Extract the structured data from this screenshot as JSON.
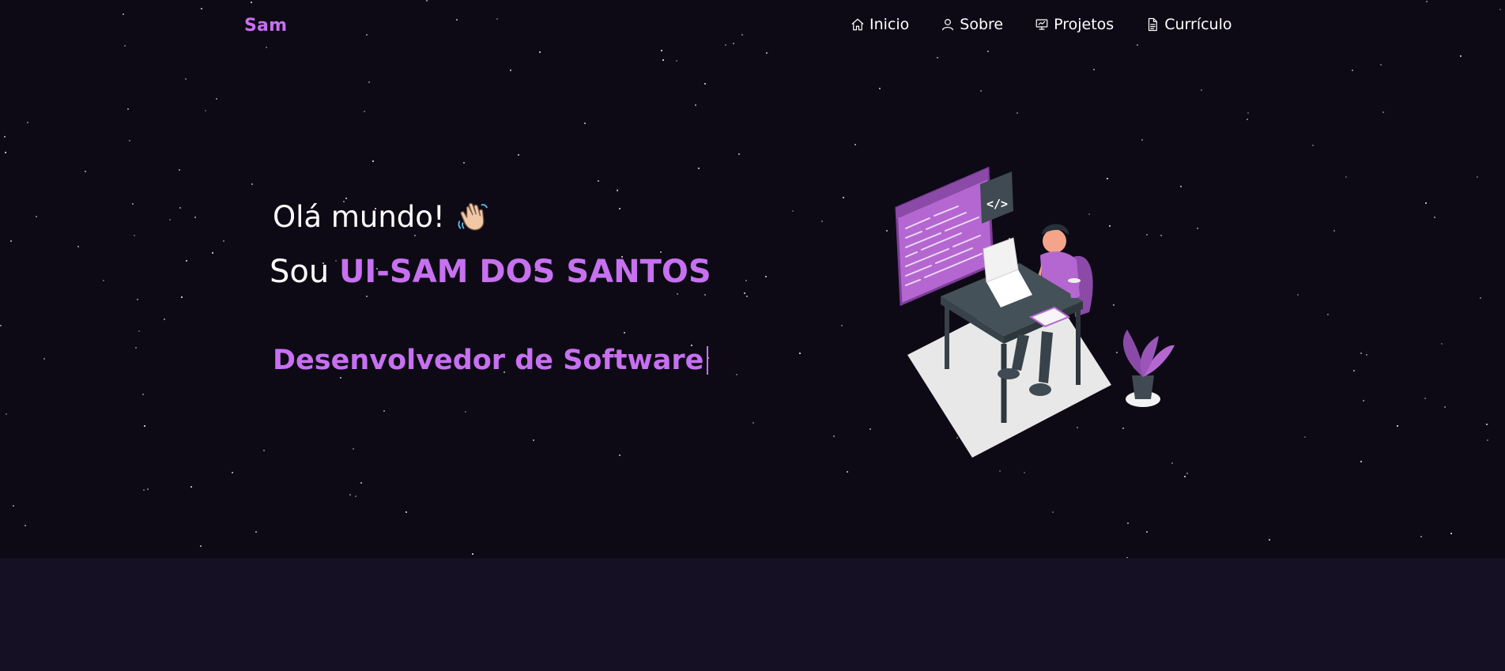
{
  "nav": {
    "brand": "Sam",
    "items": [
      {
        "label": "Inicio",
        "icon": "home-icon"
      },
      {
        "label": "Sobre",
        "icon": "user-icon"
      },
      {
        "label": "Projetos",
        "icon": "presentation-icon"
      },
      {
        "label": "Currículo",
        "icon": "document-icon"
      }
    ]
  },
  "hero": {
    "greeting": "Olá mundo!",
    "greeting_icon": "waving-hand-icon",
    "intro_prefix": "Sou",
    "name": "UI-SAM DOS SANTOS",
    "role": "Desenvolvedor de Software",
    "illustration": "developer-at-desk-illustration"
  },
  "colors": {
    "accent": "#c770f0",
    "background": "#0d0a15",
    "lower_band": "#161024",
    "text": "#ffffff"
  }
}
